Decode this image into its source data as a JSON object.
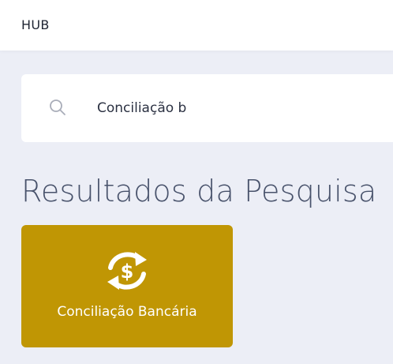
{
  "header": {
    "brand": "HUB"
  },
  "search": {
    "value": "Conciliação b",
    "icon": "search-icon"
  },
  "results": {
    "title": "Resultados da Pesquisa",
    "items": [
      {
        "label": "Conciliação Bancária",
        "icon": "currency-exchange-icon",
        "color": "#c09604"
      }
    ]
  },
  "colors": {
    "background": "#eceef6",
    "accent": "#c09604",
    "title_text": "#48526b"
  }
}
